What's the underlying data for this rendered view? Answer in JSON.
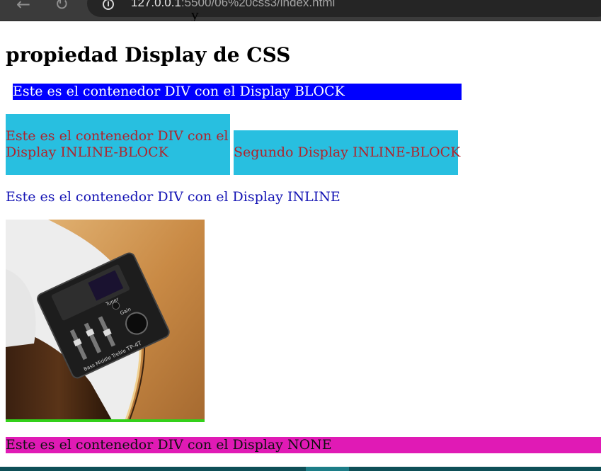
{
  "browser": {
    "url_host": "127.0.0.1",
    "url_rest": ":5500/06%20css3/index.html",
    "back_icon": "arrow-left-icon",
    "reload_icon": "reload-icon",
    "info_icon": "info-icon"
  },
  "page": {
    "heading": "propiedad Display de CSS",
    "block_text": "Este es el contenedor DIV con el Display BLOCK",
    "inline_block_text": "Este es el contenedor DIV con el Display INLINE-BLOCK",
    "inline_block_2_text": "Segundo Display INLINE-BLOCK",
    "inline_text": "Este es el contenedor DIV con el Display INLINE",
    "none_text": "Este es el contenedor DIV con el Display NONE"
  },
  "colors": {
    "block_bg": "#0000ff",
    "inline_block_bg": "#28bfe0",
    "inline_block_text": "#b0242c",
    "inline_text": "#1414b4",
    "image_border": "#33d11a",
    "none_bg": "#e01ab5"
  },
  "image": {
    "subject": "guitar-preamp-equalizer",
    "visible_labels": [
      "Tuner",
      "Bass",
      "Middle",
      "Treble",
      "Gain",
      "TP-4T"
    ]
  }
}
